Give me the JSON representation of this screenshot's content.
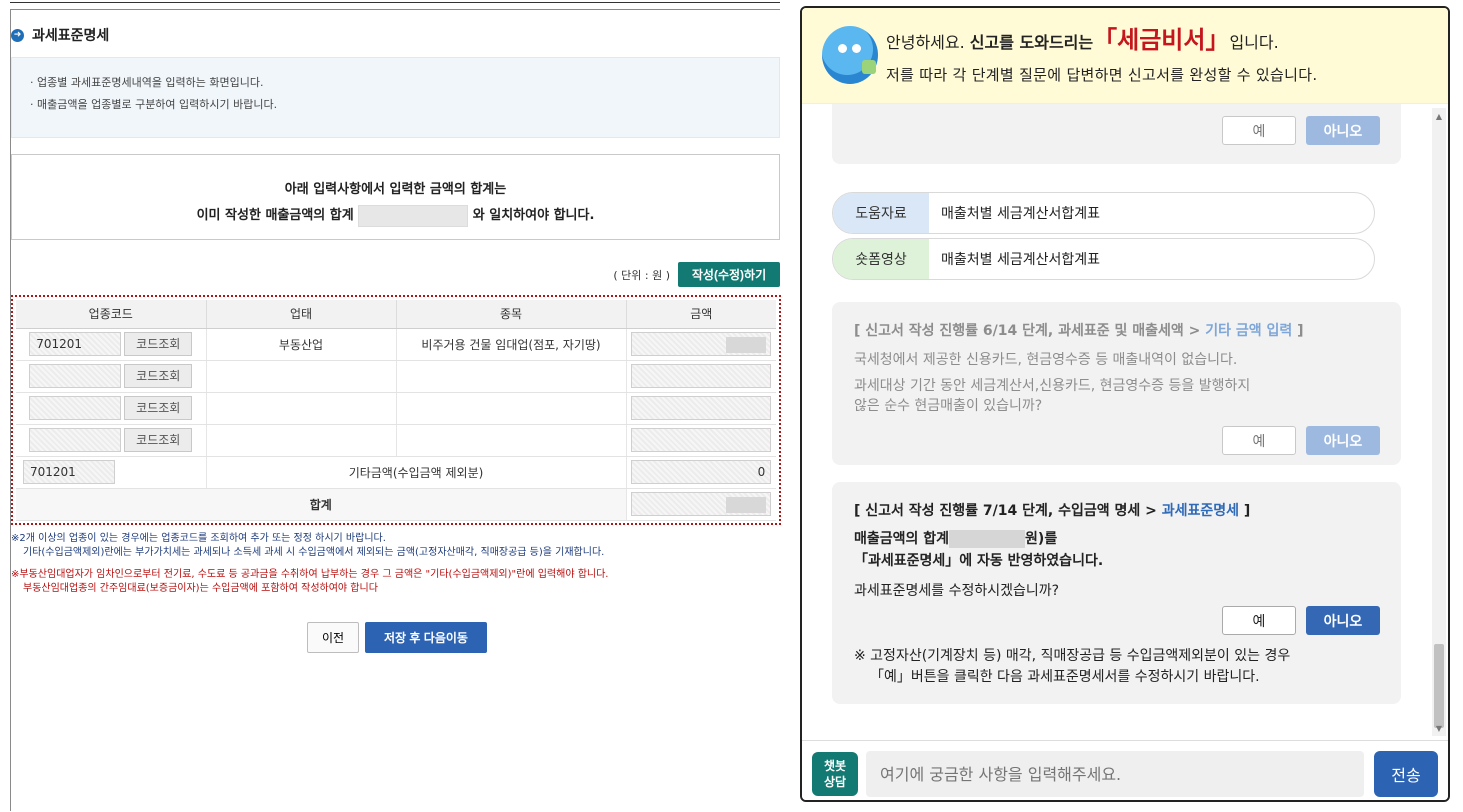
{
  "form": {
    "title": "과세표준명세",
    "info": [
      "업종별 과세표준명세내역을 입력하는 화면입니다.",
      "매출금액을 업종별로 구분하여 입력하시기 바랍니다."
    ],
    "notice_line1": "아래 입력사항에서  입력한 금액의 합계는",
    "notice_line2_a": "이미 작성한 매출금액의 합계",
    "notice_line2_b": "와 일치하여야 합니다.",
    "unit": "( 단위 : 원 )",
    "edit_button": "작성(수정)하기",
    "columns": [
      "업종코드",
      "업태",
      "종목",
      "금액"
    ],
    "code_lookup": "코드조회",
    "rows": [
      {
        "code": "701201",
        "type": "부동산업",
        "item": "비주거용 건물 임대업(점포, 자기땅)",
        "amount": ""
      },
      {
        "code": "",
        "type": "",
        "item": "",
        "amount": ""
      },
      {
        "code": "",
        "type": "",
        "item": "",
        "amount": ""
      },
      {
        "code": "",
        "type": "",
        "item": "",
        "amount": ""
      }
    ],
    "other_row": {
      "code": "701201",
      "label": "기타금액(수입금액 제외분)",
      "amount": "0"
    },
    "total_label": "합계",
    "note1_a": "2개 이상의 업종이 있는 경우에는 업종코드를 조회하여 추가 또는 정정 하시기 바랍니다.",
    "note1_b": "기타(수입금액제외)란에는 부가가치세는 과세되나 소득세 과세 시 수입금액에서 제외되는 금액(고정자산매각, 직매장공급 등)을 기재합니다.",
    "note2_a": "부동산임대업자가 임차인으로부터 전기료, 수도료 등 공과금을 수취하여 납부하는 경우  그 금액은 \"기타(수입금액제외)\"란에 입력해야 합니다.",
    "note2_b": "부동산임대업종의 간주임대료(보증금이자)는 수입금액에 포함하여 작성하여야 합니다",
    "note_mark": "※",
    "prev_button": "이전",
    "save_button": "저장 후 다음이동"
  },
  "chat": {
    "greeting_a": "안녕하세요. ",
    "greeting_b": "신고를 도와드리는",
    "brand": "「세금비서」",
    "greeting_c": "입니다.",
    "subtitle": "저를 따라 각 단계별 질문에 답변하면 신고서를 완성할 수 있습니다.",
    "yes": "예",
    "no": "아니오",
    "help_tag": "도움자료",
    "help_text": "매출처별 세금계산서합계표",
    "video_tag": "숏폼영상",
    "video_text": "매출처별 세금계산서합계표",
    "step6_title_a": "[ 신고서 작성 진행률 6/14 단계, 과세표준 및 매출세액 > ",
    "step6_title_hl": "기타 금액 입력",
    "step6_title_c": " ]",
    "step6_text1": "국세청에서 제공한 신용카드, 현금영수증 등 매출내역이 없습니다.",
    "step6_text2a": "과세대상 기간 동안 세금계산서,신용카드, 현금영수증 등을 발행하지",
    "step6_text2b": "않은 순수 현금매출이 있습니까?",
    "step7_title_a": "[ 신고서 작성 진행률 7/14 단계, 수입금액 명세 > ",
    "step7_title_hl": "과세표준명세",
    "step7_title_c": " ]",
    "step7_text1a": "매출금액의 합계",
    "step7_text1b": "원)를",
    "step7_text2": "「과세표준명세」에 자동 반영하였습니다.",
    "step7_text3": "과세표준명세를 수정하시겠습니까?",
    "step7_note1": "※ 고정자산(기계장치 등) 매각, 직매장공급 등 수입금액제외분이 있는 경우",
    "step7_note2": "「예」버튼을 클릭한 다음 과세표준명세서를 수정하시기 바랍니다.",
    "bot_label": "챗봇\n상담",
    "input_placeholder": "여기에 궁금한 사항을 입력해주세요.",
    "send": "전송"
  }
}
